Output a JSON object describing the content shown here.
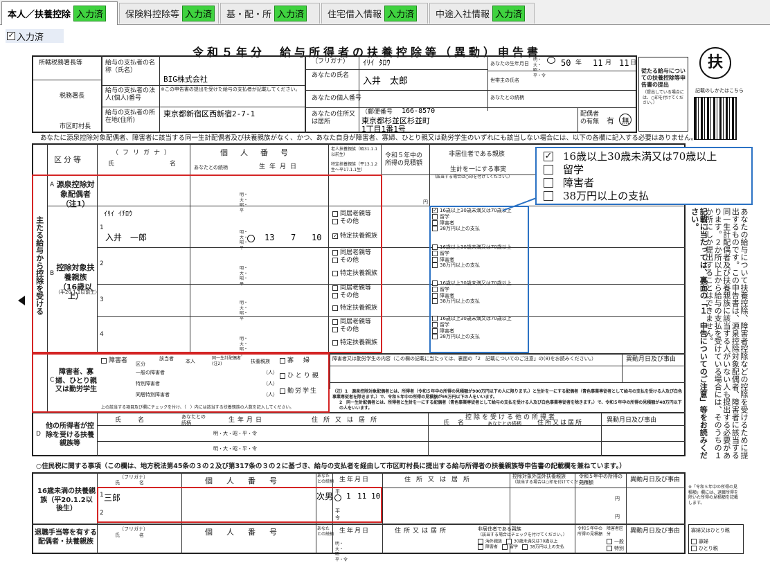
{
  "tabs": [
    {
      "label": "本人／扶養控除",
      "badge": "入力済"
    },
    {
      "label": "保険料控除等",
      "badge": "入力済"
    },
    {
      "label": "基・配・所",
      "badge": "入力済"
    },
    {
      "label": "住宅借入情報",
      "badge": "入力済"
    },
    {
      "label": "中途入社情報",
      "badge": "入力済"
    }
  ],
  "status": {
    "label": "入力済"
  },
  "form": {
    "title": "令和５年分　給与所得者の扶養控除等（異動）申告書",
    "fu_char": "扶",
    "header": {
      "tax_office": "所轄税務署長等",
      "tax_chief": "税務署長",
      "city_chief": "市区町村長",
      "payer_name_label": "給与の支払者の名称（氏名）",
      "payer_name": "BIG株式会社",
      "payer_no_label": "給与の支払者の法人(個人)番号",
      "payer_no_note": "※この申告書の提出を受けた給与の支払者が記載してください。",
      "payer_addr_label": "給与の支払者の所在地(住所)",
      "payer_addr": "東京都新宿区西新宿2-7-1",
      "furigana_label": "（フリガナ）",
      "furigana": "ｲﾘｲ ﾀﾛｳ",
      "name_label": "あなたの氏名",
      "name": "入井　太郎",
      "my_no_label": "あなたの個人番号",
      "addr_label": "あなたの住所又は居所",
      "postal_label": "（郵便番号",
      "postal": "166-8570",
      "addr_line1": "東京都杉並区杉並町",
      "addr_line2": "1丁目1番1号",
      "birth_label": "あなたの生年月日",
      "birth_era": "明・大・昭・平・令",
      "birth_year": "50",
      "birth_month": "11",
      "birth_day": "11",
      "birth_units": [
        "年",
        "月",
        "日"
      ],
      "householder_label": "世帯主の氏名",
      "relation_label": "あなたとの続柄",
      "spouse_label": "配偶者の有無",
      "spouse_yes": "有",
      "spouse_no": "無",
      "subm_label": "従たる給与についての扶養控除等申告書の提出",
      "subm_note": "（提出している場合には、○印を付けてください。）",
      "howto": "記載のしかたはこちら"
    },
    "notice": "あなたに源泉控除対象配偶者、障害者に該当する同一生計配偶者及び扶養親族がなく、かつ、あなた自身が障害者、寡婦、ひとり親又は勤労学生のいずれにも該当しない場合には、以下の各欄に記入する必要はありません。",
    "col_headers": {
      "kubun": "区分等",
      "furigana": "（フリガナ）",
      "name": "氏名",
      "kojin": "個人番号",
      "relation": "あなたとの続柄",
      "birth": "生年月日",
      "elderly": "老人扶養親族（昭31.1.1以前生）",
      "specified": "特定扶養親族（平13.1.2生～平17.1.1生）",
      "income": "令和５年中の所得の見積額",
      "nonresident": "非居住者である親族",
      "same_living": "生計を一にする事実",
      "nonres_note": "（該当する場合は○印を付けてください。）"
    },
    "main_label": "主たる給与から控除を受ける",
    "section_a": {
      "letter": "A",
      "label": "源泉控除対象配偶者（注1）",
      "era": "明・大・昭・平",
      "yen": "円"
    },
    "section_b": {
      "letter": "B",
      "label": "控除対象扶養親族（16歳以上）",
      "sub": "（平20.1.1以前生）",
      "rows": [
        {
          "num": "1",
          "furigana": "ｲﾘｲ ｲﾁﾛｳ",
          "name": "入井　一郎",
          "era": "明・大・昭・平",
          "y": "13",
          "m": "7",
          "d": "10",
          "opt1": "同居老親等",
          "opt2": "その他",
          "specific": "特定扶養親族"
        },
        {
          "num": "2",
          "furigana": "",
          "name": "",
          "era": "明・大・昭・平",
          "y": "",
          "m": "",
          "d": "",
          "opt1": "同居老親等",
          "opt2": "その他",
          "specific": "特定扶養親族"
        },
        {
          "num": "3",
          "furigana": "",
          "name": "",
          "era": "明・大・昭・平",
          "y": "",
          "m": "",
          "d": "",
          "opt1": "同居老親等",
          "opt2": "その他",
          "specific": "特定扶養親族"
        },
        {
          "num": "4",
          "furigana": "",
          "name": "",
          "era": "明・大・昭・平",
          "y": "",
          "m": "",
          "d": "",
          "opt1": "同居老親等",
          "opt2": "その他",
          "specific": "特定扶養親族"
        }
      ],
      "nonres_opts": [
        "16歳以上30歳未満又は70歳以上",
        "留学",
        "障害者",
        "38万円以上の支払"
      ]
    },
    "popup_opts": [
      "16歳以上30歳未満又は70歳以上",
      "留学",
      "障害者",
      "38万円以上の支払"
    ],
    "section_c": {
      "letter": "C",
      "label": "障害者、寡婦、ひとり親又は勤労学生",
      "disabled": "障害者",
      "kubun": "区分",
      "applicable": "該当者",
      "honnin": "本人",
      "same_spouse": "同一生計配偶者(注2)",
      "dependents": "扶養親族",
      "general": "一般の障害者",
      "special": "特別障害者",
      "living_special": "同居特別障害者",
      "widow": "寡婦",
      "single_parent": "ひとり親",
      "student": "勤労学生",
      "person_unit": "（人）",
      "note": "上の該当する項目及び欄にチェックを付け、（　）内には該当する扶養親族の人数を記入してください。",
      "detail_label": "障害者又は勤労学生の内容（この欄の記載に当たっては、裏面の「2　記載についてのご注意」の(8)をお読みください。）",
      "change_label": "異動月日及び事由",
      "footnote1": "（注）1　源泉控除対象配偶者とは、所得者（令和５年中の所得の見積額が900万円以下の人に限ります。）と生計を一にする配偶者（青色事業専従者として給与の支払を受ける人及び白色事業専従者を除きます。）で、令和５年中の所得の見積額が95万円以下の人をいいます。",
      "footnote2": "2　同一生計配偶者とは、所得者と生計を一にする配偶者（青色事業専従者として給与の支払を受ける人及び白色事業専従者を除きます。）で、令和５年中の所得の見積額が48万円以下の人をいいます。"
    },
    "section_d": {
      "letter": "D",
      "label": "他の所得者が控除を受ける扶養親族等",
      "name": "氏名",
      "relation": "あなたとの続柄",
      "birth": "生年月日",
      "addr": "住所又は居所",
      "other_header": "控除を受ける他の所得者",
      "other_name": "氏名",
      "other_relation": "あなたとの続柄",
      "other_addr": "住所又は居所",
      "change": "異動月日及び事由",
      "era": "明・大・昭・平・令"
    },
    "resident_notice": "○住民税に関する事項（この欄は、地方税法第45条の３の２及び第317条の３の２に基づき、給与の支払者を経由して市区町村長に提出する給与所得者の扶養親族等申告書の記載欄を兼ねています。）",
    "under16": {
      "label": "16歳未満の扶養親族（平20.1.2以後生）",
      "furigana": "（フリガナ）",
      "name": "氏名",
      "kojin": "個人番号",
      "relation": "あなたとの続柄",
      "birth": "生年月日",
      "addr": "住所又は居所",
      "abroad": "控除対象外国外扶養親族",
      "abroad_note": "（該当する場合は○印を付けてください。）",
      "income": "令和５年中の所得の見積額",
      "change": "異動月日及び事由",
      "rows": [
        {
          "num": "1",
          "name": "三郎",
          "relation": "次男",
          "era_top": "平",
          "era_bottom": "令",
          "y": "1",
          "m": "11",
          "d": "10"
        },
        {
          "num": "2",
          "name": "",
          "relation": "",
          "era_top": "平",
          "era_bottom": "令",
          "y": "",
          "m": "",
          "d": ""
        }
      ],
      "yen": "円",
      "side_note": "※「令和５年中の所得の見積額」欄には、退職所得を除いた所得の見積額を記載します。"
    },
    "retire": {
      "label": "退職手当等を有する配偶者・扶養親族",
      "furigana": "（フリガナ）",
      "name": "氏名",
      "kojin": "個人番号",
      "relation": "あなたとの続柄",
      "birth": "生年月日",
      "addr": "住所又は居所",
      "nonres": "非居住者である親族",
      "nonres_note": "（該当する場合はチェックを付けてください。）",
      "opt_a": "海外親族",
      "opt_b": "30歳未満又は70歳以上",
      "opt_c": "留学",
      "opt_d": "障害者",
      "opt_e": "38万円以上の支払",
      "income": "令和５年中の所得の見積額",
      "disabled_kubun": "障害者区分",
      "dis_general": "一般",
      "dis_special": "特別",
      "change": "異動月日及び事由",
      "widow_single": "寡婦又はひとり親",
      "widow": "寡婦",
      "single": "ひとり親",
      "era": "明・大・昭・平・令",
      "yen": "円"
    },
    "side_text": "あなたの給与について扶養控除、障害者控除などの控除を受けるために提出するものです。この申告書は、源泉控除対象配偶者、障害者に該当する同一生計配偶者及び扶養親族に該当する人がいない人も提出する必要があります。２か所以上から給与の支払を受けている場合には、そのうちの１か所にしか提出することはできません。",
    "side_text_bold": "記載に当たっては、裏面の「１　申告についてのご注意」等をお読みください。"
  }
}
